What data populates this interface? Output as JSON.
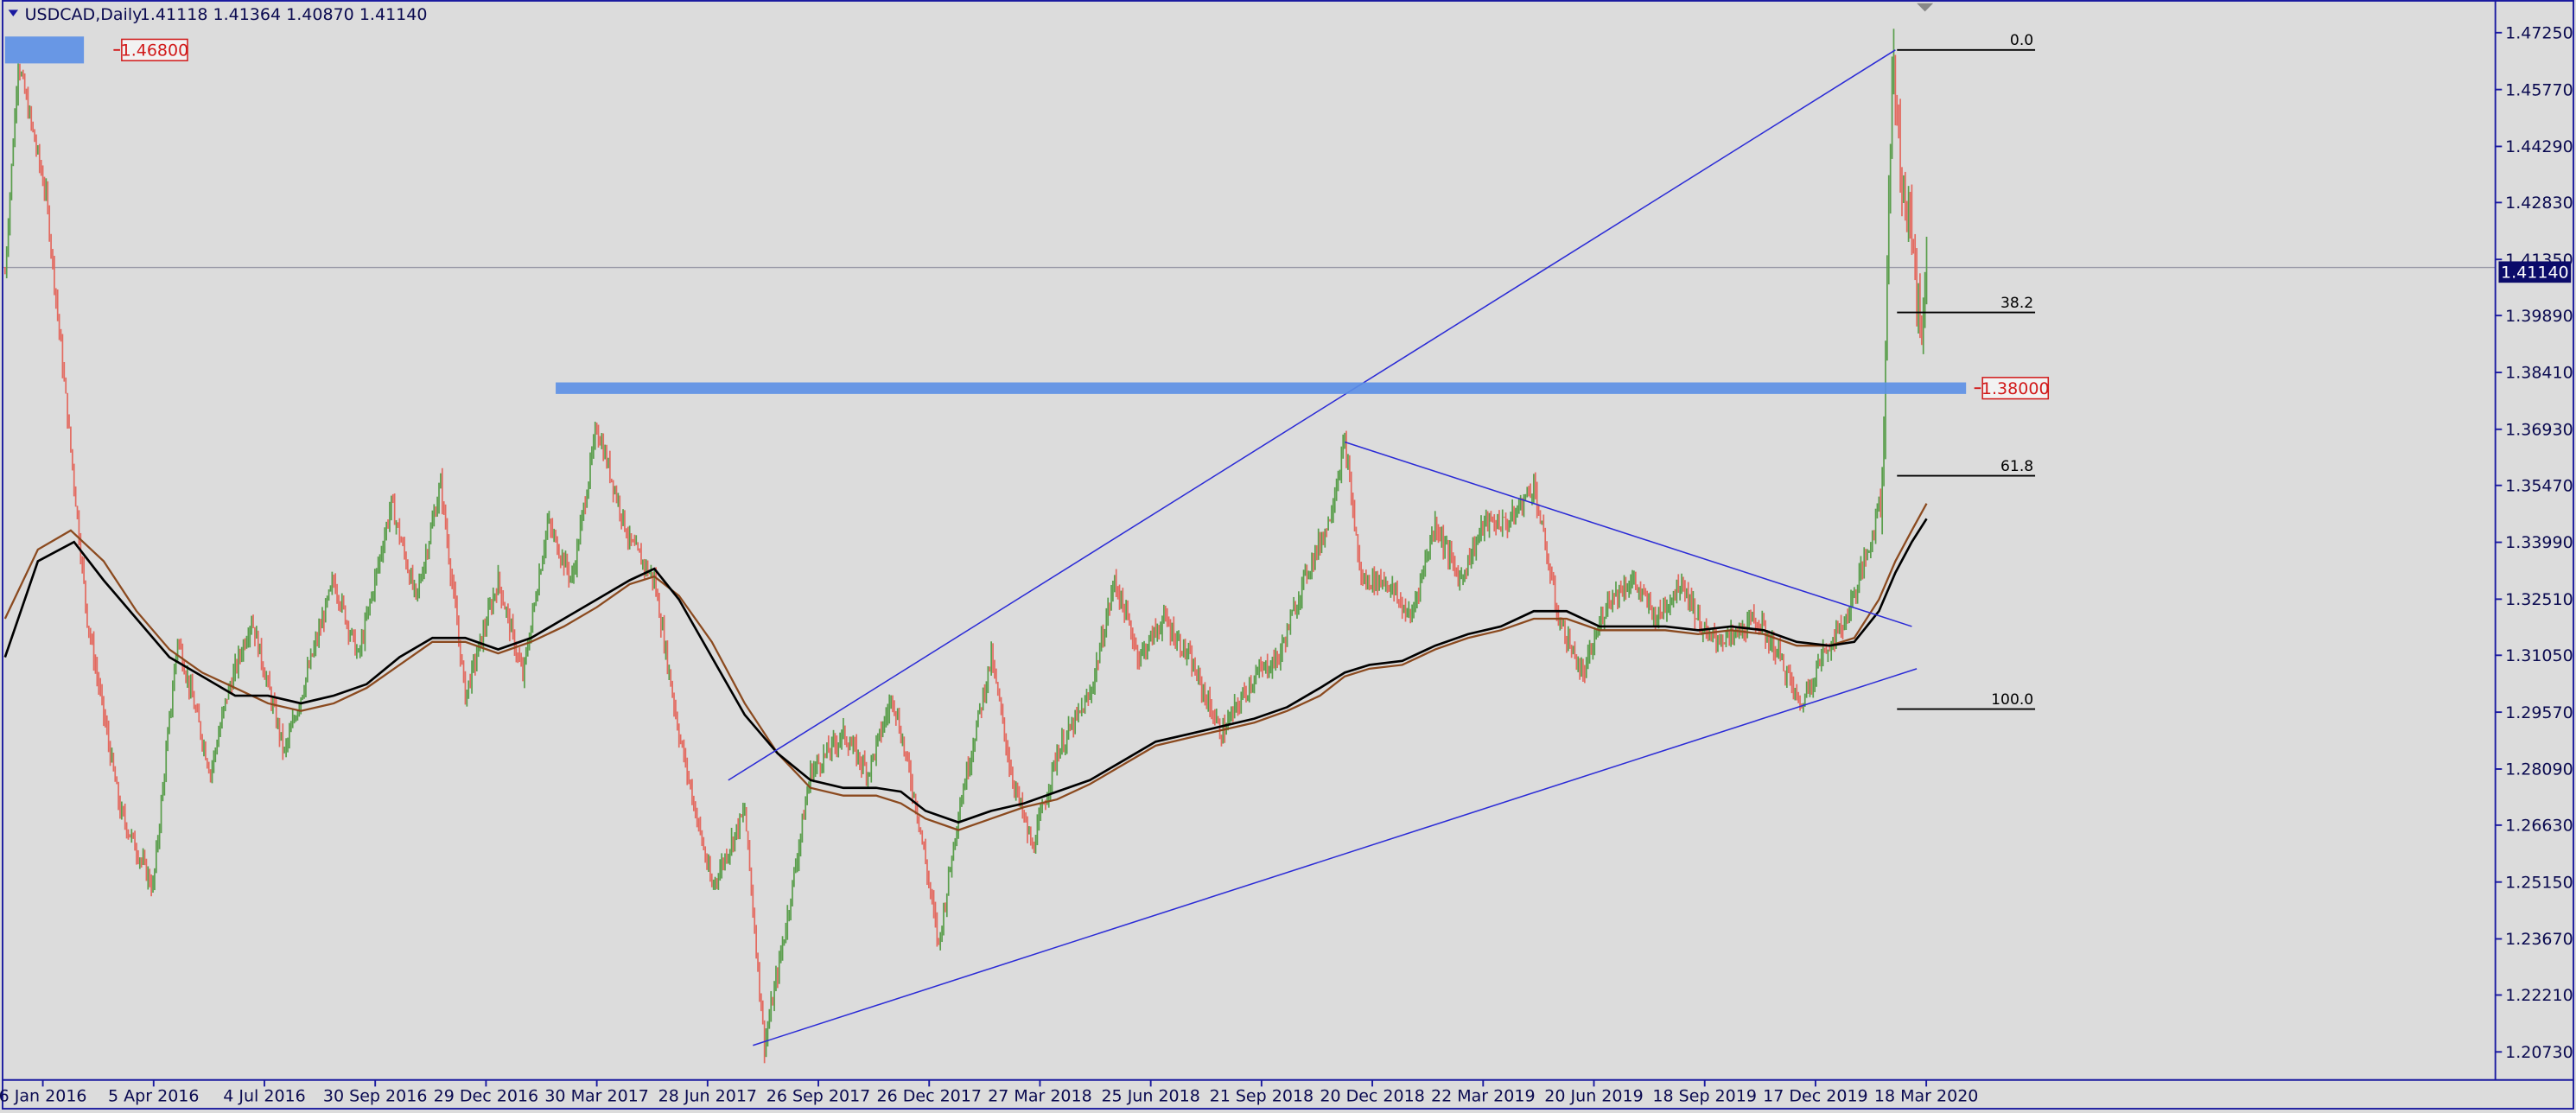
{
  "header": {
    "menu_icon": "triangle-down-icon",
    "symbol": "USDCAD,Daily",
    "ohlc": "1.41118 1.41364 1.40870 1.41140"
  },
  "colors": {
    "background": "#dcdcdc",
    "axis": "#1a1aa0",
    "bull": "#5a9e4c",
    "bear": "#e36a60",
    "trendline": "#2b2bd6",
    "zone": "#5b8fe6",
    "price_tag_bg": "#0b0b6a",
    "price_label": "#d11a1a",
    "ma_fast": "#000000",
    "ma_slow": "#8b4a1f",
    "fib": "#000000"
  },
  "chart_data": {
    "type": "candlestick",
    "title": "USDCAD,Daily",
    "ylim": [
      1.2,
      1.481
    ],
    "y_ticks": [
      "1.47250",
      "1.45770",
      "1.44290",
      "1.42830",
      "1.41350",
      "1.39890",
      "1.38410",
      "1.36930",
      "1.35470",
      "1.33990",
      "1.32510",
      "1.31050",
      "1.29570",
      "1.28090",
      "1.26630",
      "1.25150",
      "1.23670",
      "1.22210",
      "1.20730"
    ],
    "x_ticks": [
      "6 Jan 2016",
      "5 Apr 2016",
      "4 Jul 2016",
      "30 Sep 2016",
      "29 Dec 2016",
      "30 Mar 2017",
      "28 Jun 2017",
      "26 Sep 2017",
      "26 Dec 2017",
      "27 Mar 2018",
      "25 Jun 2018",
      "21 Sep 2018",
      "20 Dec 2018",
      "22 Mar 2019",
      "20 Jun 2019",
      "18 Sep 2019",
      "17 Dec 2019",
      "18 Mar 2020"
    ],
    "last_price": "1.41140",
    "price_path": [
      [
        0,
        1.41
      ],
      [
        8,
        1.465
      ],
      [
        25,
        1.43
      ],
      [
        50,
        1.32
      ],
      [
        70,
        1.27
      ],
      [
        90,
        1.25
      ],
      [
        105,
        1.315
      ],
      [
        125,
        1.28
      ],
      [
        135,
        1.3
      ],
      [
        150,
        1.32
      ],
      [
        170,
        1.285
      ],
      [
        190,
        1.315
      ],
      [
        200,
        1.33
      ],
      [
        215,
        1.31
      ],
      [
        235,
        1.35
      ],
      [
        250,
        1.325
      ],
      [
        265,
        1.355
      ],
      [
        280,
        1.3
      ],
      [
        300,
        1.33
      ],
      [
        315,
        1.305
      ],
      [
        330,
        1.345
      ],
      [
        345,
        1.33
      ],
      [
        360,
        1.37
      ],
      [
        380,
        1.34
      ],
      [
        395,
        1.33
      ],
      [
        410,
        1.29
      ],
      [
        430,
        1.25
      ],
      [
        450,
        1.27
      ],
      [
        462,
        1.209
      ],
      [
        475,
        1.24
      ],
      [
        490,
        1.28
      ],
      [
        510,
        1.29
      ],
      [
        525,
        1.28
      ],
      [
        540,
        1.3
      ],
      [
        555,
        1.27
      ],
      [
        568,
        1.235
      ],
      [
        580,
        1.27
      ],
      [
        600,
        1.31
      ],
      [
        612,
        1.28
      ],
      [
        625,
        1.26
      ],
      [
        640,
        1.285
      ],
      [
        660,
        1.3
      ],
      [
        675,
        1.33
      ],
      [
        690,
        1.31
      ],
      [
        705,
        1.32
      ],
      [
        720,
        1.31
      ],
      [
        740,
        1.29
      ],
      [
        760,
        1.305
      ],
      [
        775,
        1.31
      ],
      [
        790,
        1.33
      ],
      [
        805,
        1.345
      ],
      [
        815,
        1.366
      ],
      [
        825,
        1.33
      ],
      [
        840,
        1.33
      ],
      [
        855,
        1.32
      ],
      [
        870,
        1.345
      ],
      [
        885,
        1.33
      ],
      [
        900,
        1.345
      ],
      [
        915,
        1.345
      ],
      [
        930,
        1.355
      ],
      [
        945,
        1.32
      ],
      [
        960,
        1.305
      ],
      [
        975,
        1.325
      ],
      [
        990,
        1.33
      ],
      [
        1005,
        1.32
      ],
      [
        1020,
        1.33
      ],
      [
        1035,
        1.315
      ],
      [
        1050,
        1.315
      ],
      [
        1065,
        1.32
      ],
      [
        1080,
        1.31
      ],
      [
        1092,
        1.297
      ],
      [
        1105,
        1.31
      ],
      [
        1120,
        1.32
      ],
      [
        1135,
        1.34
      ],
      [
        1142,
        1.355
      ],
      [
        1148,
        1.466
      ],
      [
        1155,
        1.43
      ],
      [
        1160,
        1.42
      ],
      [
        1165,
        1.395
      ],
      [
        1169,
        1.4114
      ]
    ],
    "ma_fast_path": [
      [
        0,
        1.31
      ],
      [
        20,
        1.335
      ],
      [
        42,
        1.34
      ],
      [
        60,
        1.33
      ],
      [
        80,
        1.32
      ],
      [
        100,
        1.31
      ],
      [
        120,
        1.305
      ],
      [
        140,
        1.3
      ],
      [
        160,
        1.3
      ],
      [
        180,
        1.298
      ],
      [
        200,
        1.3
      ],
      [
        220,
        1.303
      ],
      [
        240,
        1.31
      ],
      [
        260,
        1.315
      ],
      [
        280,
        1.315
      ],
      [
        300,
        1.312
      ],
      [
        320,
        1.315
      ],
      [
        340,
        1.32
      ],
      [
        360,
        1.325
      ],
      [
        380,
        1.33
      ],
      [
        395,
        1.333
      ],
      [
        410,
        1.325
      ],
      [
        430,
        1.31
      ],
      [
        450,
        1.295
      ],
      [
        470,
        1.285
      ],
      [
        490,
        1.278
      ],
      [
        510,
        1.276
      ],
      [
        530,
        1.276
      ],
      [
        545,
        1.275
      ],
      [
        560,
        1.27
      ],
      [
        580,
        1.267
      ],
      [
        600,
        1.27
      ],
      [
        620,
        1.272
      ],
      [
        640,
        1.275
      ],
      [
        660,
        1.278
      ],
      [
        680,
        1.283
      ],
      [
        700,
        1.288
      ],
      [
        720,
        1.29
      ],
      [
        740,
        1.292
      ],
      [
        760,
        1.294
      ],
      [
        780,
        1.297
      ],
      [
        800,
        1.302
      ],
      [
        815,
        1.306
      ],
      [
        830,
        1.308
      ],
      [
        850,
        1.309
      ],
      [
        870,
        1.313
      ],
      [
        890,
        1.316
      ],
      [
        910,
        1.318
      ],
      [
        930,
        1.322
      ],
      [
        950,
        1.322
      ],
      [
        970,
        1.318
      ],
      [
        990,
        1.318
      ],
      [
        1010,
        1.318
      ],
      [
        1030,
        1.317
      ],
      [
        1050,
        1.318
      ],
      [
        1070,
        1.317
      ],
      [
        1090,
        1.314
      ],
      [
        1110,
        1.313
      ],
      [
        1125,
        1.314
      ],
      [
        1140,
        1.322
      ],
      [
        1150,
        1.332
      ],
      [
        1160,
        1.34
      ],
      [
        1169,
        1.346
      ]
    ],
    "ma_slow_path": [
      [
        0,
        1.32
      ],
      [
        20,
        1.338
      ],
      [
        40,
        1.343
      ],
      [
        60,
        1.335
      ],
      [
        80,
        1.322
      ],
      [
        100,
        1.312
      ],
      [
        120,
        1.306
      ],
      [
        140,
        1.302
      ],
      [
        160,
        1.298
      ],
      [
        180,
        1.296
      ],
      [
        200,
        1.298
      ],
      [
        220,
        1.302
      ],
      [
        240,
        1.308
      ],
      [
        260,
        1.314
      ],
      [
        280,
        1.314
      ],
      [
        300,
        1.311
      ],
      [
        320,
        1.314
      ],
      [
        340,
        1.318
      ],
      [
        360,
        1.323
      ],
      [
        380,
        1.329
      ],
      [
        395,
        1.331
      ],
      [
        410,
        1.326
      ],
      [
        430,
        1.314
      ],
      [
        450,
        1.298
      ],
      [
        470,
        1.285
      ],
      [
        490,
        1.276
      ],
      [
        510,
        1.274
      ],
      [
        530,
        1.274
      ],
      [
        545,
        1.272
      ],
      [
        560,
        1.268
      ],
      [
        580,
        1.265
      ],
      [
        600,
        1.268
      ],
      [
        620,
        1.271
      ],
      [
        640,
        1.273
      ],
      [
        660,
        1.277
      ],
      [
        680,
        1.282
      ],
      [
        700,
        1.287
      ],
      [
        720,
        1.289
      ],
      [
        740,
        1.291
      ],
      [
        760,
        1.293
      ],
      [
        780,
        1.296
      ],
      [
        800,
        1.3
      ],
      [
        815,
        1.305
      ],
      [
        830,
        1.307
      ],
      [
        850,
        1.308
      ],
      [
        870,
        1.312
      ],
      [
        890,
        1.315
      ],
      [
        910,
        1.317
      ],
      [
        930,
        1.32
      ],
      [
        950,
        1.32
      ],
      [
        970,
        1.317
      ],
      [
        990,
        1.317
      ],
      [
        1010,
        1.317
      ],
      [
        1030,
        1.316
      ],
      [
        1050,
        1.317
      ],
      [
        1070,
        1.316
      ],
      [
        1090,
        1.313
      ],
      [
        1110,
        1.313
      ],
      [
        1125,
        1.315
      ],
      [
        1140,
        1.325
      ],
      [
        1150,
        1.335
      ],
      [
        1160,
        1.343
      ],
      [
        1169,
        1.35
      ]
    ],
    "trendlines": [
      {
        "p1": [
          440,
          1.278
        ],
        "p2": [
          1150,
          1.468
        ]
      },
      {
        "p1": [
          455,
          1.209
        ],
        "p2": [
          1163,
          1.307
        ]
      },
      {
        "p1": [
          815,
          1.366
        ],
        "p2": [
          1160,
          1.318
        ]
      }
    ],
    "zones": [
      {
        "y_top": 1.4715,
        "y_bottom": 1.4645,
        "x1": 2,
        "x2": 50,
        "label": "1.46800"
      },
      {
        "y_top": 1.3815,
        "y_bottom": 1.3785,
        "x1": 337,
        "x2": 1195,
        "label": "1.38000"
      }
    ],
    "fibonacci": [
      {
        "level": "0.0",
        "price": 1.468
      },
      {
        "level": "38.2",
        "price": 1.3997
      },
      {
        "level": "61.8",
        "price": 1.3572
      },
      {
        "level": "100.0",
        "price": 1.2965
      }
    ]
  }
}
